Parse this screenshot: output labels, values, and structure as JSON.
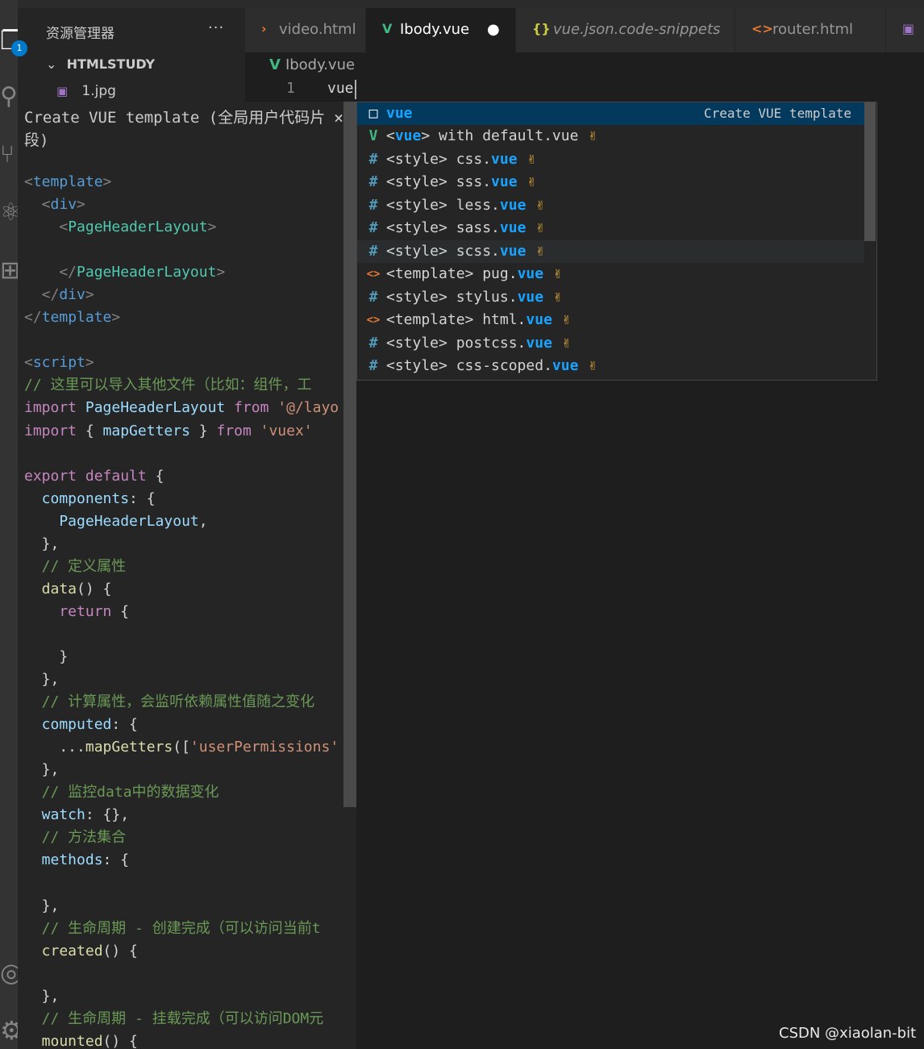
{
  "activity_bar": {
    "items": [
      {
        "name": "explorer-icon",
        "glyph": "❐"
      },
      {
        "name": "search-icon",
        "glyph": "⚲"
      },
      {
        "name": "source-control-icon",
        "glyph": "⑂"
      },
      {
        "name": "debug-icon",
        "glyph": "⚛"
      },
      {
        "name": "extensions-icon",
        "glyph": "⊞"
      },
      {
        "name": "account-icon",
        "glyph": "◎"
      },
      {
        "name": "settings-gear-icon",
        "glyph": "⚙"
      }
    ],
    "explorer_badge": "1"
  },
  "sidebar": {
    "title": "资源管理器",
    "more": "···",
    "folder": "HTMLSTUDY",
    "files": [
      {
        "name": "1.jpg",
        "icon": "image-file-icon"
      }
    ]
  },
  "tabs": [
    {
      "label": "video.html",
      "icon": "html-icon",
      "glyph": "›",
      "color": "#e37933",
      "italic": false,
      "active": false
    },
    {
      "label": "Ibody.vue",
      "icon": "vue-icon",
      "glyph": "V",
      "color": "#41b883",
      "italic": false,
      "active": true,
      "dirty": "●"
    },
    {
      "label": "vue.json.code-snippets",
      "icon": "json-braces-icon",
      "glyph": "{}",
      "color": "#cbcb41",
      "italic": true,
      "active": false
    },
    {
      "label": "router.html",
      "icon": "html-icon",
      "glyph": "<>",
      "color": "#e37933",
      "italic": false,
      "active": false
    },
    {
      "label": "",
      "icon": "image-file-icon",
      "glyph": "▣",
      "color": "#a074c4",
      "italic": false,
      "active": false
    }
  ],
  "editor": {
    "breadcrumb": "Ibody.vue",
    "line_number": "1",
    "typed_text": "vue"
  },
  "details_panel": {
    "title": "Create VUE template (全局用户代码片段)",
    "close": "×",
    "code_lines": [
      {
        "parts": [
          {
            "t": "<",
            "c": "#808080"
          },
          {
            "t": "template",
            "c": "#569cd6"
          },
          {
            "t": ">",
            "c": "#808080"
          }
        ]
      },
      {
        "parts": [
          {
            "t": "  <",
            "c": "#808080"
          },
          {
            "t": "div",
            "c": "#569cd6"
          },
          {
            "t": ">",
            "c": "#808080"
          }
        ]
      },
      {
        "parts": [
          {
            "t": "    <",
            "c": "#808080"
          },
          {
            "t": "PageHeaderLayout",
            "c": "#4ec9b0"
          },
          {
            "t": ">",
            "c": "#808080"
          }
        ]
      },
      {
        "parts": []
      },
      {
        "parts": [
          {
            "t": "    </",
            "c": "#808080"
          },
          {
            "t": "PageHeaderLayout",
            "c": "#4ec9b0"
          },
          {
            "t": ">",
            "c": "#808080"
          }
        ]
      },
      {
        "parts": [
          {
            "t": "  </",
            "c": "#808080"
          },
          {
            "t": "div",
            "c": "#569cd6"
          },
          {
            "t": ">",
            "c": "#808080"
          }
        ]
      },
      {
        "parts": [
          {
            "t": "</",
            "c": "#808080"
          },
          {
            "t": "template",
            "c": "#569cd6"
          },
          {
            "t": ">",
            "c": "#808080"
          }
        ]
      },
      {
        "parts": []
      },
      {
        "parts": [
          {
            "t": "<",
            "c": "#808080"
          },
          {
            "t": "script",
            "c": "#569cd6"
          },
          {
            "t": ">",
            "c": "#808080"
          }
        ]
      },
      {
        "parts": [
          {
            "t": "// 这里可以导入其他文件（比如：组件，工",
            "c": "#6a9955"
          }
        ]
      },
      {
        "parts": [
          {
            "t": "import ",
            "c": "#c586c0"
          },
          {
            "t": "PageHeaderLayout ",
            "c": "#9cdcfe"
          },
          {
            "t": "from ",
            "c": "#c586c0"
          },
          {
            "t": "'@/layo",
            "c": "#ce9178"
          }
        ]
      },
      {
        "parts": [
          {
            "t": "import ",
            "c": "#c586c0"
          },
          {
            "t": "{ ",
            "c": "#d4d4d4"
          },
          {
            "t": "mapGetters",
            "c": "#9cdcfe"
          },
          {
            "t": " } ",
            "c": "#d4d4d4"
          },
          {
            "t": "from ",
            "c": "#c586c0"
          },
          {
            "t": "'vuex'",
            "c": "#ce9178"
          }
        ]
      },
      {
        "parts": []
      },
      {
        "parts": [
          {
            "t": "export default ",
            "c": "#c586c0"
          },
          {
            "t": "{",
            "c": "#d4d4d4"
          }
        ]
      },
      {
        "parts": [
          {
            "t": "  components",
            "c": "#9cdcfe"
          },
          {
            "t": ": {",
            "c": "#d4d4d4"
          }
        ]
      },
      {
        "parts": [
          {
            "t": "    PageHeaderLayout",
            "c": "#9cdcfe"
          },
          {
            "t": ",",
            "c": "#d4d4d4"
          }
        ]
      },
      {
        "parts": [
          {
            "t": "  },",
            "c": "#d4d4d4"
          }
        ]
      },
      {
        "parts": [
          {
            "t": "  // 定义属性",
            "c": "#6a9955"
          }
        ]
      },
      {
        "parts": [
          {
            "t": "  data",
            "c": "#dcdcaa"
          },
          {
            "t": "() {",
            "c": "#d4d4d4"
          }
        ]
      },
      {
        "parts": [
          {
            "t": "    return ",
            "c": "#c586c0"
          },
          {
            "t": "{",
            "c": "#d4d4d4"
          }
        ]
      },
      {
        "parts": []
      },
      {
        "parts": [
          {
            "t": "    }",
            "c": "#d4d4d4"
          }
        ]
      },
      {
        "parts": [
          {
            "t": "  },",
            "c": "#d4d4d4"
          }
        ]
      },
      {
        "parts": [
          {
            "t": "  // 计算属性，会监听依赖属性值随之变化",
            "c": "#6a9955"
          }
        ]
      },
      {
        "parts": [
          {
            "t": "  computed",
            "c": "#9cdcfe"
          },
          {
            "t": ": {",
            "c": "#d4d4d4"
          }
        ]
      },
      {
        "parts": [
          {
            "t": "    ...",
            "c": "#d4d4d4"
          },
          {
            "t": "mapGetters",
            "c": "#dcdcaa"
          },
          {
            "t": "([",
            "c": "#d4d4d4"
          },
          {
            "t": "'userPermissions'",
            "c": "#ce9178"
          }
        ]
      },
      {
        "parts": [
          {
            "t": "  },",
            "c": "#d4d4d4"
          }
        ]
      },
      {
        "parts": [
          {
            "t": "  // 监控data中的数据变化",
            "c": "#6a9955"
          }
        ]
      },
      {
        "parts": [
          {
            "t": "  watch",
            "c": "#9cdcfe"
          },
          {
            "t": ": {},",
            "c": "#d4d4d4"
          }
        ]
      },
      {
        "parts": [
          {
            "t": "  // 方法集合",
            "c": "#6a9955"
          }
        ]
      },
      {
        "parts": [
          {
            "t": "  methods",
            "c": "#9cdcfe"
          },
          {
            "t": ": {",
            "c": "#d4d4d4"
          }
        ]
      },
      {
        "parts": []
      },
      {
        "parts": [
          {
            "t": "  },",
            "c": "#d4d4d4"
          }
        ]
      },
      {
        "parts": [
          {
            "t": "  // 生命周期 - 创建完成（可以访问当前t",
            "c": "#6a9955"
          }
        ]
      },
      {
        "parts": [
          {
            "t": "  created",
            "c": "#dcdcaa"
          },
          {
            "t": "() {",
            "c": "#d4d4d4"
          }
        ]
      },
      {
        "parts": []
      },
      {
        "parts": [
          {
            "t": "  },",
            "c": "#d4d4d4"
          }
        ]
      },
      {
        "parts": [
          {
            "t": "  // 生命周期 - 挂载完成（可以访问DOM元",
            "c": "#6a9955"
          }
        ]
      },
      {
        "parts": [
          {
            "t": "  mounted",
            "c": "#dcdcaa"
          },
          {
            "t": "() {",
            "c": "#d4d4d4"
          }
        ]
      }
    ]
  },
  "suggestions": {
    "selected_index": 0,
    "hover_index": 6,
    "items": [
      {
        "icon": "snippet-icon",
        "glyph": "□",
        "icon_color": "#ffffff",
        "before": "",
        "match": "vue",
        "after": "",
        "emoji": "",
        "detail": "Create VUE template"
      },
      {
        "icon": "vue-icon",
        "glyph": "V",
        "icon_color": "#41b883",
        "before": "<",
        "match": "vue",
        "after": "> with default.vue",
        "emoji": "✌",
        "detail": ""
      },
      {
        "icon": "css-hash-icon",
        "glyph": "#",
        "icon_color": "#519aba",
        "before": "<style> css.",
        "match": "vue",
        "after": "",
        "emoji": "✌",
        "detail": ""
      },
      {
        "icon": "css-hash-icon",
        "glyph": "#",
        "icon_color": "#519aba",
        "before": "<style> sss.",
        "match": "vue",
        "after": "",
        "emoji": "✌",
        "detail": ""
      },
      {
        "icon": "css-hash-icon",
        "glyph": "#",
        "icon_color": "#519aba",
        "before": "<style> less.",
        "match": "vue",
        "after": "",
        "emoji": "✌",
        "detail": ""
      },
      {
        "icon": "css-hash-icon",
        "glyph": "#",
        "icon_color": "#519aba",
        "before": "<style> sass.",
        "match": "vue",
        "after": "",
        "emoji": "✌",
        "detail": ""
      },
      {
        "icon": "css-hash-icon",
        "glyph": "#",
        "icon_color": "#519aba",
        "before": "<style> scss.",
        "match": "vue",
        "after": "",
        "emoji": "✌",
        "detail": ""
      },
      {
        "icon": "html-tag-icon",
        "glyph": "<>",
        "icon_color": "#e37933",
        "before": "<template> pug.",
        "match": "vue",
        "after": "",
        "emoji": "✌",
        "detail": ""
      },
      {
        "icon": "css-hash-icon",
        "glyph": "#",
        "icon_color": "#519aba",
        "before": "<style> stylus.",
        "match": "vue",
        "after": "",
        "emoji": "✌",
        "detail": ""
      },
      {
        "icon": "html-tag-icon",
        "glyph": "<>",
        "icon_color": "#e37933",
        "before": "<template> html.",
        "match": "vue",
        "after": "",
        "emoji": "✌",
        "detail": ""
      },
      {
        "icon": "css-hash-icon",
        "glyph": "#",
        "icon_color": "#519aba",
        "before": "<style> postcss.",
        "match": "vue",
        "after": "",
        "emoji": "✌",
        "detail": ""
      },
      {
        "icon": "css-hash-icon",
        "glyph": "#",
        "icon_color": "#519aba",
        "before": "<style> css-scoped.",
        "match": "vue",
        "after": "",
        "emoji": "✌",
        "detail": ""
      }
    ]
  },
  "watermark": "CSDN @xiaolan-bit"
}
